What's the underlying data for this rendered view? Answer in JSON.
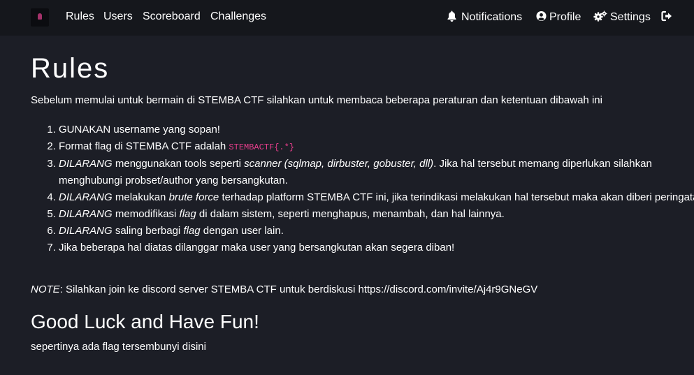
{
  "nav": {
    "left": [
      {
        "label": "Rules"
      },
      {
        "label": "Users"
      },
      {
        "label": "Scoreboard"
      },
      {
        "label": "Challenges"
      }
    ],
    "notifications_label": "Notifications",
    "profile_label": "Profile",
    "settings_label": "Settings",
    "icons": {
      "notifications": "bell-icon",
      "profile": "user-circle-icon",
      "settings": "cogs-icon",
      "logout": "sign-out-icon"
    }
  },
  "page": {
    "title": "Rules",
    "intro": "Sebelum memulai untuk bermain di STEMBA CTF silahkan untuk membaca beberapa peraturan dan ketentuan dibawah ini",
    "rules": [
      {
        "parts": [
          {
            "t": "GUNAKAN username yang sopan!"
          }
        ]
      },
      {
        "parts": [
          {
            "t": "Format flag di STEMBA CTF adalah "
          },
          {
            "t": "STEMBACTF{.*}",
            "s": "code"
          }
        ]
      },
      {
        "parts": [
          {
            "t": "DILARANG",
            "s": "em"
          },
          {
            "t": " menggunakan tools seperti "
          },
          {
            "t": "scanner (sqlmap, dirbuster, gobuster, dll)",
            "s": "em"
          },
          {
            "t": ". Jika hal tersebut memang diperlukan silahkan menghubungi probset/author yang bersangkutan."
          }
        ]
      },
      {
        "parts": [
          {
            "t": "DILARANG",
            "s": "em"
          },
          {
            "t": " melakukan "
          },
          {
            "t": "brute force",
            "s": "em"
          },
          {
            "t": " terhadap platform STEMBA CTF ini, jika terindikasi melakukan hal tersebut maka akan diberi peringatan."
          }
        ]
      },
      {
        "parts": [
          {
            "t": "DILARANG",
            "s": "em"
          },
          {
            "t": " memodifikasi "
          },
          {
            "t": "flag",
            "s": "em"
          },
          {
            "t": " di dalam sistem, seperti menghapus, menambah, dan hal lainnya."
          }
        ]
      },
      {
        "parts": [
          {
            "t": "DILARANG",
            "s": "em"
          },
          {
            "t": " saling berbagi "
          },
          {
            "t": "flag",
            "s": "em"
          },
          {
            "t": " dengan user lain."
          }
        ]
      },
      {
        "parts": [
          {
            "t": "Jika beberapa hal diatas dilanggar maka user yang bersangkutan akan segera diban!"
          }
        ]
      }
    ],
    "note_label": "NOTE",
    "note_text": ": Silahkan join ke discord server STEMBA CTF untuk berdiskusi https://discord.com/invite/Aj4r9GNeGV",
    "subheading": "Good Luck and Have Fun!",
    "hint": "sepertinya ada flag tersembunyi disini"
  },
  "colors": {
    "background": "#1c1e26",
    "navbar": "#15171c",
    "code": "#e83e8c",
    "logo_accent": "#a4326a"
  }
}
